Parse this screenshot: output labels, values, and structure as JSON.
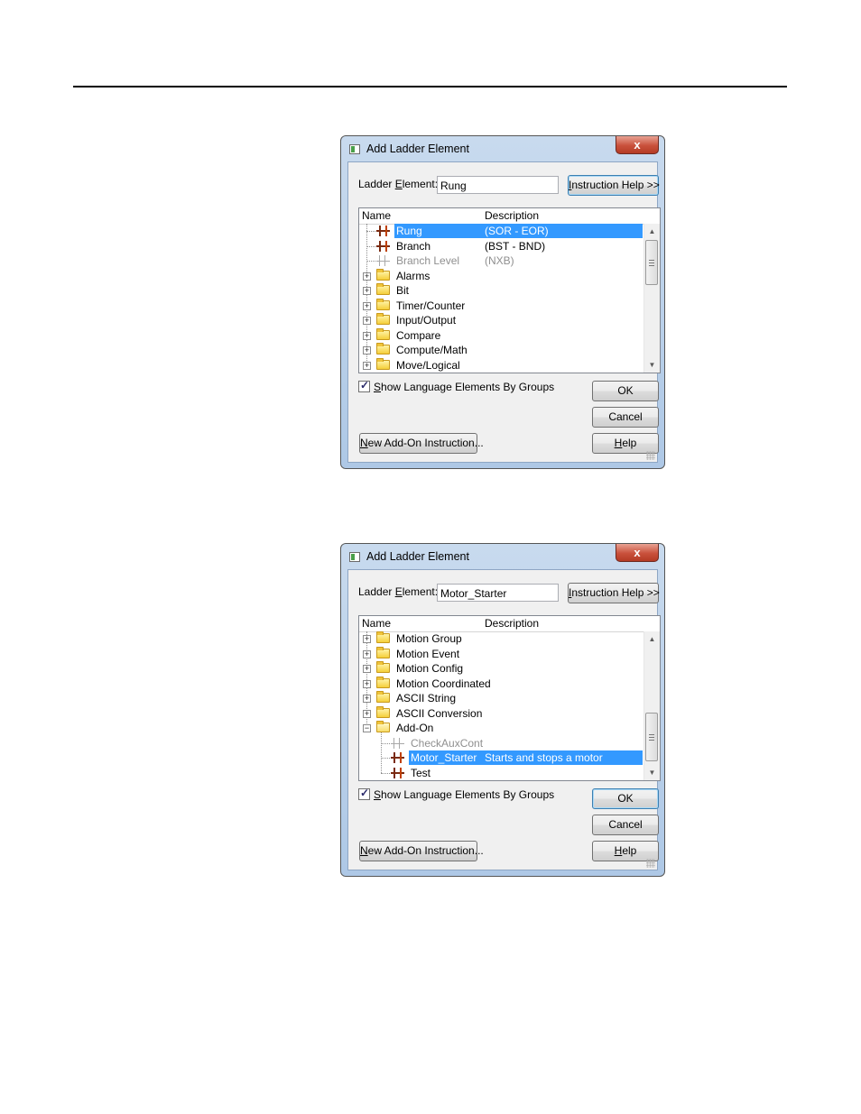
{
  "dialog1": {
    "title": "Add Ladder Element",
    "close_label": "x",
    "element_label_pre": "Ladder ",
    "element_label_key": "E",
    "element_label_post": "lement:",
    "element_value": "Rung",
    "instruction_help_key": "I",
    "instruction_help_rest": "nstruction Help >>",
    "columns": {
      "name": "Name",
      "description": "Description"
    },
    "rows": [
      {
        "name": "Rung",
        "description": "(SOR - EOR)"
      },
      {
        "name": "Branch",
        "description": "(BST - BND)"
      },
      {
        "name": "Branch Level",
        "description": "(NXB)"
      },
      {
        "name": "Alarms",
        "description": ""
      },
      {
        "name": "Bit",
        "description": ""
      },
      {
        "name": "Timer/Counter",
        "description": ""
      },
      {
        "name": "Input/Output",
        "description": ""
      },
      {
        "name": "Compare",
        "description": ""
      },
      {
        "name": "Compute/Math",
        "description": ""
      },
      {
        "name": "Move/Logical",
        "description": ""
      }
    ],
    "show_groups_key": "S",
    "show_groups_rest": "how Language Elements By Groups",
    "ok_label": "OK",
    "cancel_label": "Cancel",
    "new_aoi_key": "N",
    "new_aoi_rest": "ew Add-On Instruction...",
    "help_key": "H",
    "help_rest": "elp"
  },
  "dialog2": {
    "title": "Add Ladder Element",
    "close_label": "x",
    "element_label_pre": "Ladder ",
    "element_label_key": "E",
    "element_label_post": "lement:",
    "element_value": "Motor_Starter",
    "instruction_help_key": "I",
    "instruction_help_rest": "nstruction Help >>",
    "columns": {
      "name": "Name",
      "description": "Description"
    },
    "rows": [
      {
        "name": "Motion Group",
        "description": ""
      },
      {
        "name": "Motion Event",
        "description": ""
      },
      {
        "name": "Motion Config",
        "description": ""
      },
      {
        "name": "Motion Coordinated",
        "description": ""
      },
      {
        "name": "ASCII String",
        "description": ""
      },
      {
        "name": "ASCII Conversion",
        "description": ""
      },
      {
        "name": "Add-On",
        "description": ""
      },
      {
        "name": "CheckAuxCont",
        "description": ""
      },
      {
        "name": "Motor_Starter",
        "description": "Starts and stops a motor"
      },
      {
        "name": "Test",
        "description": ""
      }
    ],
    "show_groups_key": "S",
    "show_groups_rest": "how Language Elements By Groups",
    "ok_label": "OK",
    "cancel_label": "Cancel",
    "new_aoi_key": "N",
    "new_aoi_rest": "ew Add-On Instruction...",
    "help_key": "H",
    "help_rest": "elp"
  }
}
